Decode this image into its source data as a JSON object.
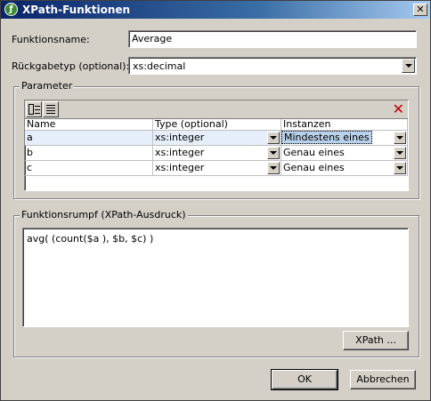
{
  "window": {
    "title": "XPath-Funktionen",
    "app_icon_glyph": "ƒ",
    "close_glyph": "✕"
  },
  "form": {
    "name_label": "Funktionsname:",
    "name_value": "Average",
    "return_label": "Rückgabetyp (optional):",
    "return_value": "xs:decimal"
  },
  "parameters": {
    "group_label": "Parameter",
    "toolbar": {
      "insert_icon": "insert-row-icon",
      "append_icon": "append-row-icon",
      "delete_icon": "delete-icon",
      "delete_glyph": "✕",
      "delete_color": "#c00000"
    },
    "columns": [
      "Name",
      "Type (optional)",
      "Instanzen"
    ],
    "rows": [
      {
        "name": "a",
        "type": "xs:integer",
        "instances": "Mindestens eines"
      },
      {
        "name": "b",
        "type": "xs:integer",
        "instances": "Genau eines"
      },
      {
        "name": "c",
        "type": "xs:integer",
        "instances": "Genau eines"
      }
    ]
  },
  "body": {
    "group_label": "Funktionsrumpf (XPath-Ausdruck)",
    "expression": "avg( (count($a ), $b, $c) )",
    "xpath_button": "XPath ..."
  },
  "buttons": {
    "ok": "OK",
    "cancel": "Abbrechen"
  }
}
